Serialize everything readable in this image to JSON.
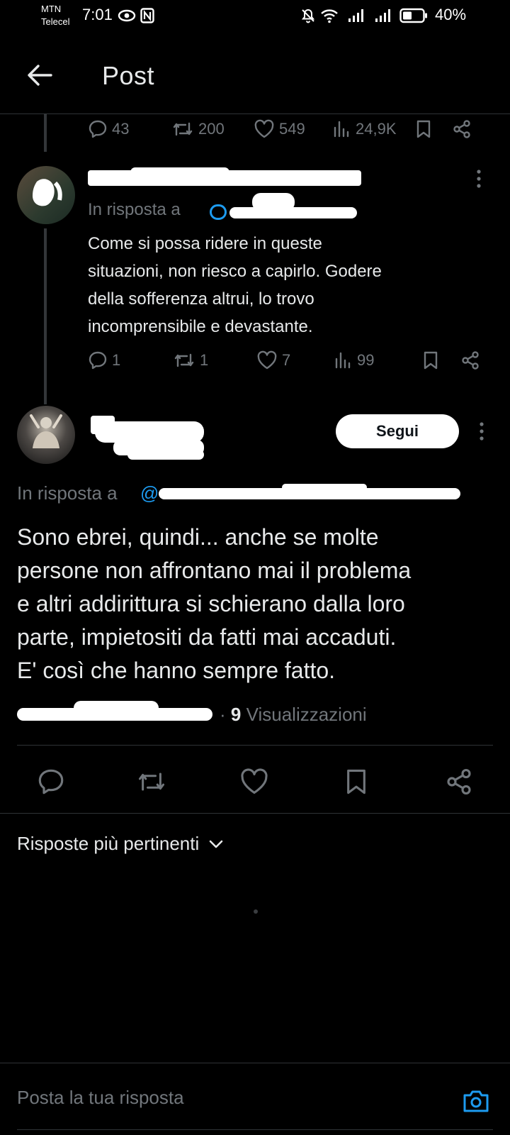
{
  "status_bar": {
    "carrier_1": "MTN",
    "carrier_2": "Telecel",
    "time": "7:01",
    "battery": "40%"
  },
  "header": {
    "title": "Post"
  },
  "first_tweet_actions": {
    "replies": "43",
    "reposts": "200",
    "likes": "549",
    "views": "24,9K"
  },
  "reply": {
    "replying_to_label": "In risposta a",
    "text_lines": [
      "Come si possa ridere in queste",
      "situazioni, non riesco a capirlo. Godere",
      "della sofferenza altrui, lo trovo",
      "incomprensibile e devastante."
    ],
    "actions": {
      "replies": "1",
      "reposts": "1",
      "likes": "7",
      "views": "99"
    }
  },
  "main_post": {
    "follow_label": "Segui",
    "replying_to_label": "In risposta a",
    "text_lines": [
      "Sono ebrei, quindi... anche se molte",
      "persone non affrontano mai il problema",
      "e altri addirittura si schierano dalla loro",
      "parte, impietositi da fatti mai accaduti.",
      "E' così che hanno sempre fatto."
    ],
    "views_count": "9",
    "views_label": "Visualizzazioni"
  },
  "replies_sort": {
    "label": "Risposte più pertinenti"
  },
  "composer": {
    "placeholder": "Posta la tua risposta"
  },
  "colors": {
    "background": "#000000",
    "text": "#e7e9ea",
    "muted": "#71767b",
    "accent": "#1d9bf0"
  }
}
